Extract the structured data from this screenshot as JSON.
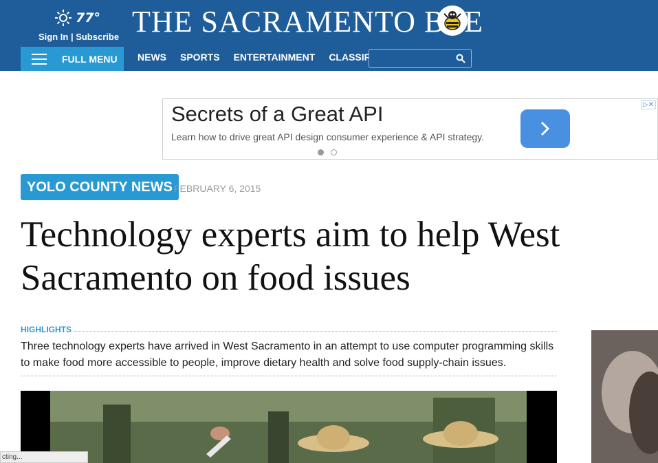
{
  "header": {
    "temperature": "77°",
    "signin_text": "Sign In | Subscribe",
    "masthead": "THE SACRAMENTO BEE",
    "menu_label": "FULL MENU",
    "nav": [
      "NEWS",
      "SPORTS",
      "ENTERTAINMENT",
      "CLASSIFIEDS"
    ],
    "search_placeholder": ""
  },
  "ad": {
    "title": "Secrets of a Great API",
    "text": "Learn how to drive great API design consumer experience & API strategy.",
    "choices": "▷✕"
  },
  "article": {
    "section": "YOLO COUNTY NEWS",
    "date": "FEBRUARY 6, 2015",
    "headline": "Technology experts aim to help West Sacramento on food issues",
    "highlights_label": "HIGHLIGHTS",
    "highlights_text": "Three technology experts have arrived in West Sacramento in an attempt to use computer programming skills to make food more accessible to people, improve dietary health and solve food supply-chain issues."
  },
  "status_bar": "cting...",
  "colors": {
    "header_bg": "#1e5d99",
    "accent": "#2899d3",
    "ad_button": "#4a90e2"
  },
  "icons": [
    "sun-icon",
    "bee-logo-icon",
    "hamburger-icon",
    "search-icon",
    "chevron-right-icon"
  ]
}
